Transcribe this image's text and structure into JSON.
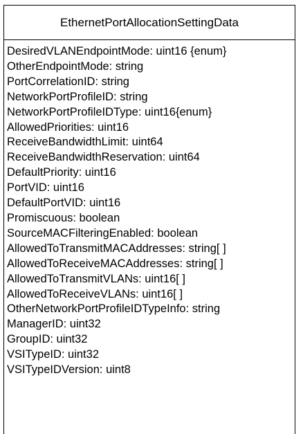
{
  "class_name": "EthernetPortAllocationSettingData",
  "attributes": [
    "DesiredVLANEndpointMode: uint16 {enum}",
    "OtherEndpointMode: string",
    "PortCorrelationID: string",
    "NetworkPortProfileID: string",
    "NetworkPortProfileIDType: uint16{enum}",
    "AllowedPriorities: uint16",
    "ReceiveBandwidthLimit: uint64",
    "ReceiveBandwidthReservation: uint64",
    "DefaultPriority: uint16",
    "PortVID: uint16",
    "DefaultPortVID: uint16",
    "Promiscuous: boolean",
    "SourceMACFilteringEnabled: boolean",
    "AllowedToTransmitMACAddresses: string[ ]",
    "AllowedToReceiveMACAddresses: string[ ]",
    "AllowedToTransmitVLANs: uint16[ ]",
    "AllowedToReceiveVLANs: uint16[ ]",
    "OtherNetworkPortProfileIDTypeInfo: string",
    "ManagerID: uint32",
    "GroupID: uint32",
    "VSITypeID: uint32",
    "VSITypeIDVersion: uint8"
  ]
}
